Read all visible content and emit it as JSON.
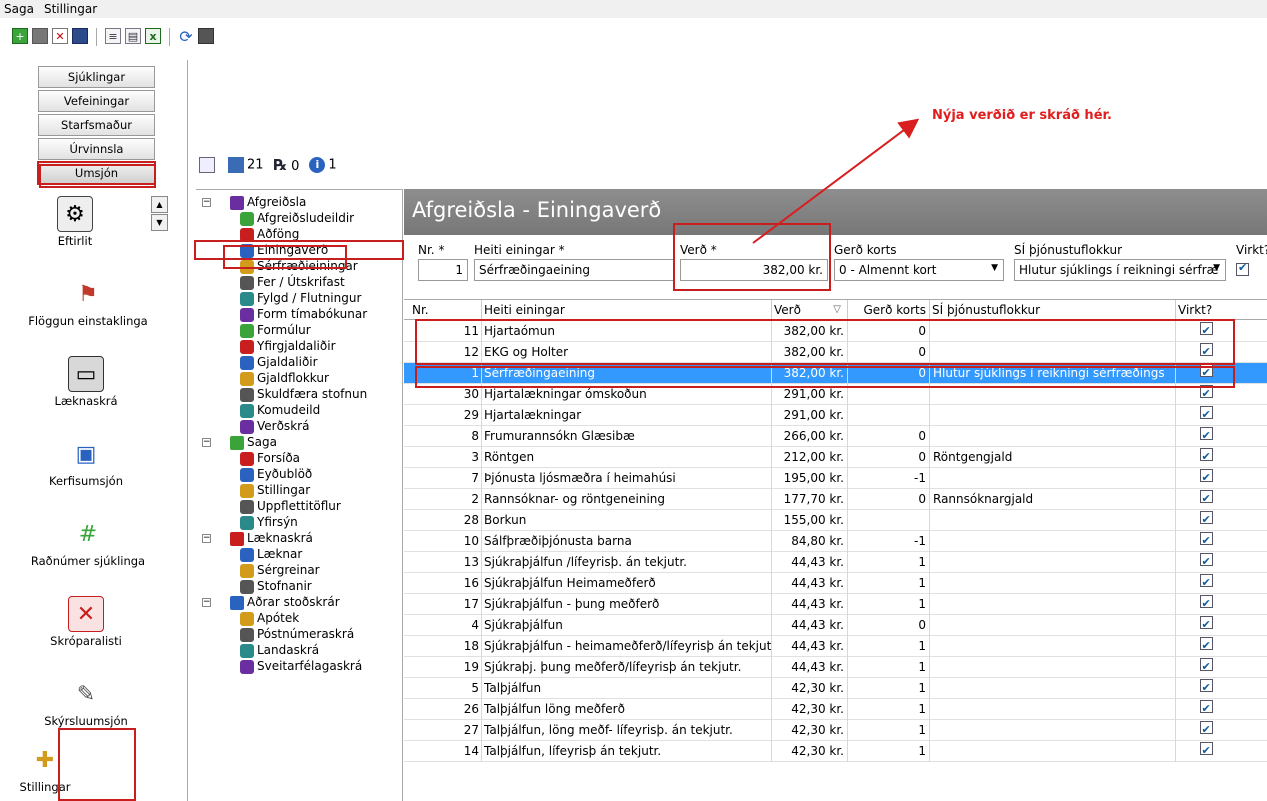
{
  "menu": {
    "items": [
      "Saga",
      "Stillingar"
    ]
  },
  "nav": {
    "buttons": [
      "Sjúklingar",
      "Vefeiningar",
      "Starfsmaður",
      "Úrvinnsla",
      "Umsjón"
    ],
    "icons": [
      {
        "label": "Eftirlit",
        "icon": "gear-icon"
      },
      {
        "label": "Flöggun einstaklinga",
        "icon": "person-flag-icon"
      },
      {
        "label": "Læknaskrá",
        "icon": "cabinet-icon"
      },
      {
        "label": "Kerfisumsjón",
        "icon": "user-computer-icon"
      },
      {
        "label": "Raðnúmer sjúklinga",
        "icon": "user-grid-icon"
      },
      {
        "label": "Skróparalisti",
        "icon": "calendar-x-icon"
      },
      {
        "label": "Skýrsluumsjón",
        "icon": "report-pen-icon"
      },
      {
        "label": "Stillingar",
        "icon": "toolbox-icon"
      }
    ]
  },
  "status": {
    "mail_count": "21",
    "rx_count": "0",
    "info_count": "1"
  },
  "tree": {
    "groups": [
      {
        "label": "Afgreiðsla",
        "children": [
          "Afgreiðsludeildir",
          "Aðföng",
          "Einingaverð",
          "Sérfræðieiningar",
          "Fer / Útskrifast",
          "Fylgd / Flutningur",
          "Form tímabókunar",
          "Formúlur",
          "Yfirgjaldaliðir",
          "Gjaldaliðir",
          "Gjaldflokkur",
          "Skuldfæra stofnun",
          "Komudeild",
          "Verðskrá"
        ]
      },
      {
        "label": "Saga",
        "children": [
          "Forsíða",
          "Eyðublöð",
          "Stillingar",
          "Uppflettitöflur",
          "Yfirsýn"
        ]
      },
      {
        "label": "Læknaskrá",
        "children": [
          "Læknar",
          "Sérgreinar",
          "Stofnanir"
        ]
      },
      {
        "label": "Aðrar stoðskrár",
        "children": [
          "Apótek",
          "Póstnúmeraskrá",
          "Landaskrá",
          "Sveitarfélagaskrá"
        ]
      }
    ]
  },
  "panel": {
    "title": "Afgreiðsla - Einingaverð",
    "form": {
      "nr_label": "Nr. *",
      "nr_value": "1",
      "heiti_label": "Heiti einingar *",
      "heiti_value": "Sérfræðingaeining",
      "verd_label": "Verð *",
      "verd_value": "382,00 kr.",
      "kort_label": "Gerð korts",
      "kort_value": "0 - Almennt kort",
      "sj_label": "SÍ þjónustuflokkur",
      "sj_value": "Hlutur sjúklings í reikningi sérfræ",
      "virkt_label": "Virkt?"
    },
    "columns": [
      "Nr.",
      "Heiti einingar",
      "Verð",
      "Gerð korts",
      "SÍ þjónustuflokkur",
      "Virkt?"
    ],
    "rows": [
      {
        "nr": "11",
        "name": "Hjartaómun",
        "price": "382,00 kr.",
        "kort": "0",
        "sj": ""
      },
      {
        "nr": "12",
        "name": "EKG og Holter",
        "price": "382,00 kr.",
        "kort": "0",
        "sj": ""
      },
      {
        "nr": "1",
        "name": "Sérfræðingaeining",
        "price": "382,00 kr.",
        "kort": "0",
        "sj": "Hlutur sjúklings í reikningi sérfræðings"
      },
      {
        "nr": "30",
        "name": "Hjartalækningar ómskoðun",
        "price": "291,00 kr.",
        "kort": "",
        "sj": ""
      },
      {
        "nr": "29",
        "name": "Hjartalækningar",
        "price": "291,00 kr.",
        "kort": "",
        "sj": ""
      },
      {
        "nr": "8",
        "name": "Frumurannsókn Glæsibæ",
        "price": "266,00 kr.",
        "kort": "0",
        "sj": ""
      },
      {
        "nr": "3",
        "name": "Röntgen",
        "price": "212,00 kr.",
        "kort": "0",
        "sj": "Röntgengjald"
      },
      {
        "nr": "7",
        "name": "Þjónusta ljósmæðra í heimahúsi",
        "price": "195,00 kr.",
        "kort": "-1",
        "sj": ""
      },
      {
        "nr": "2",
        "name": "Rannsóknar- og röntgeneining",
        "price": "177,70 kr.",
        "kort": "0",
        "sj": "Rannsóknargjald"
      },
      {
        "nr": "28",
        "name": "Borkun",
        "price": "155,00 kr.",
        "kort": "",
        "sj": ""
      },
      {
        "nr": "10",
        "name": "Sálfþræðiþjónusta barna",
        "price": "84,80 kr.",
        "kort": "-1",
        "sj": ""
      },
      {
        "nr": "13",
        "name": "Sjúkraþjálfun /lífeyrisþ. án tekjutr.",
        "price": "44,43 kr.",
        "kort": "1",
        "sj": ""
      },
      {
        "nr": "16",
        "name": "Sjúkraþjálfun Heimameðferð",
        "price": "44,43 kr.",
        "kort": "1",
        "sj": ""
      },
      {
        "nr": "17",
        "name": "Sjúkraþjálfun - þung meðferð",
        "price": "44,43 kr.",
        "kort": "1",
        "sj": ""
      },
      {
        "nr": "4",
        "name": "Sjúkraþjálfun",
        "price": "44,43 kr.",
        "kort": "0",
        "sj": ""
      },
      {
        "nr": "18",
        "name": "Sjúkraþjálfun - heimameðferð/lífeyrisþ án tekjut",
        "price": "44,43 kr.",
        "kort": "1",
        "sj": ""
      },
      {
        "nr": "19",
        "name": "Sjúkraþj. þung meðferð/lífeyrisþ án tekjutr.",
        "price": "44,43 kr.",
        "kort": "1",
        "sj": ""
      },
      {
        "nr": "5",
        "name": "Talþjálfun",
        "price": "42,30 kr.",
        "kort": "1",
        "sj": ""
      },
      {
        "nr": "26",
        "name": "Talþjálfun löng meðferð",
        "price": "42,30 kr.",
        "kort": "1",
        "sj": ""
      },
      {
        "nr": "27",
        "name": "Talþjálfun, löng meðf- lífeyrisþ. án tekjutr.",
        "price": "42,30 kr.",
        "kort": "1",
        "sj": ""
      },
      {
        "nr": "14",
        "name": "Talþjálfun, lífeyrisþ án tekjutr.",
        "price": "42,30 kr.",
        "kort": "1",
        "sj": ""
      }
    ]
  },
  "annotation": {
    "text": "Nýja verðið er skráð hér.",
    "color": "#e01e1e"
  },
  "colors": {
    "selection": "#3399ff",
    "highlight": "#c81e1e",
    "header": "#808080"
  }
}
